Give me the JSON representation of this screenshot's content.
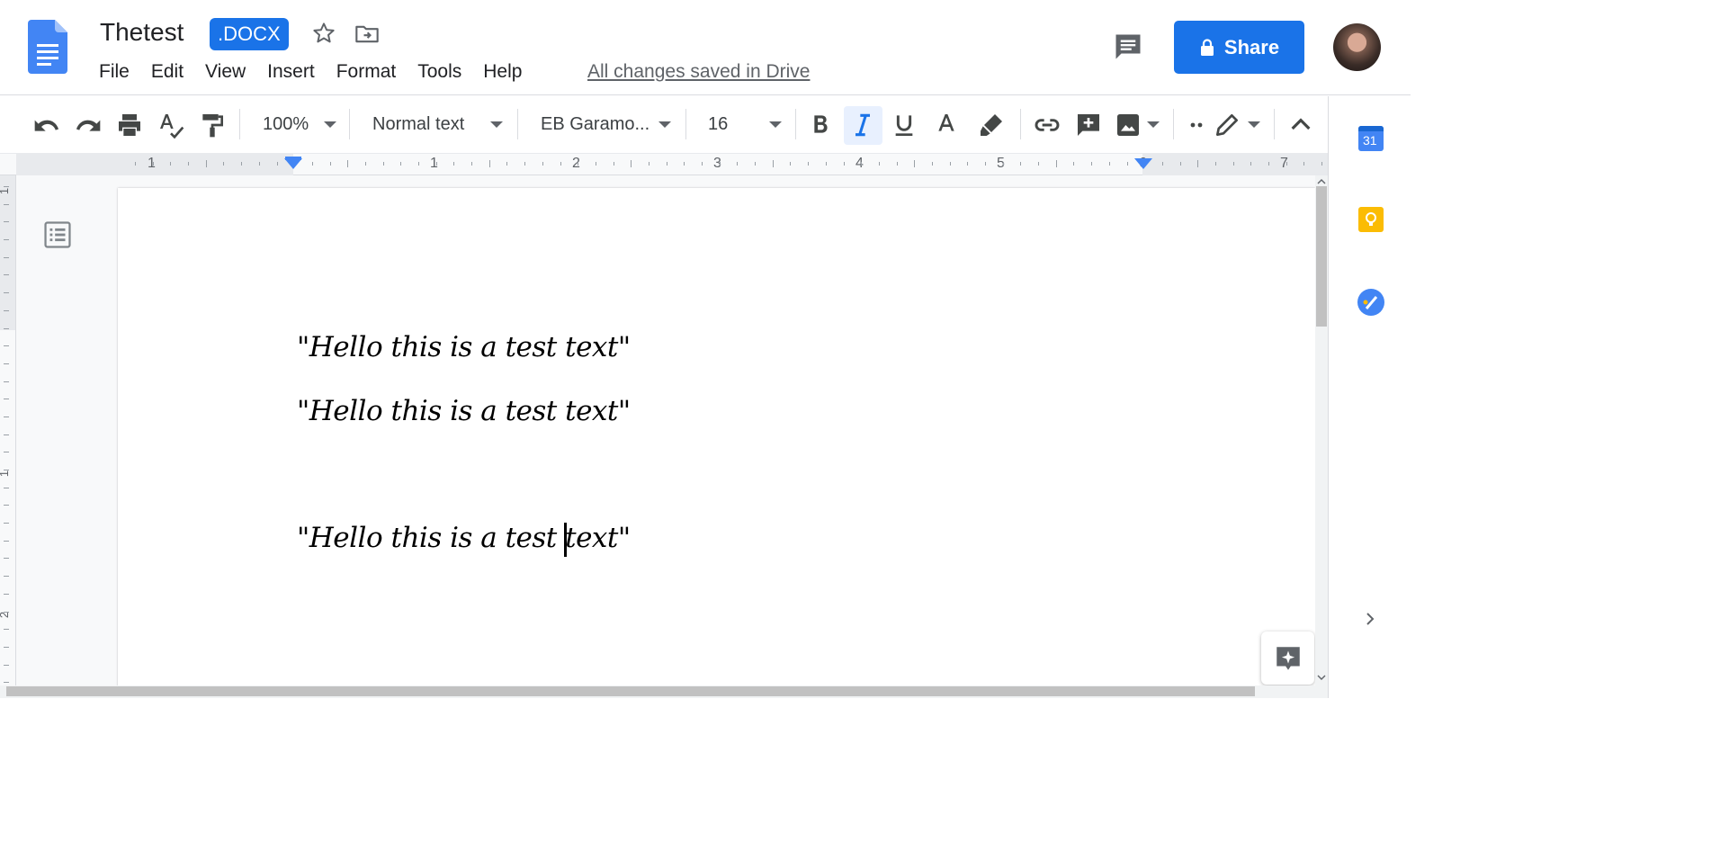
{
  "header": {
    "doc_title": "Thetest",
    "badge": ".DOCX",
    "menu": [
      "File",
      "Edit",
      "View",
      "Insert",
      "Format",
      "Tools",
      "Help"
    ],
    "saved_status": "All changes saved in Drive",
    "share_label": "Share"
  },
  "toolbar": {
    "zoom": "100%",
    "style": "Normal text",
    "font": "EB Garamo...",
    "font_size": "16"
  },
  "ruler": {
    "labels": [
      "1",
      "1",
      "2",
      "3",
      "4",
      "5",
      "6",
      "7"
    ],
    "vertical_labels": [
      "1",
      "1",
      "2"
    ]
  },
  "document": {
    "lines": [
      "\"Hello this is a test text\"",
      "\"Hello this is a test text\"",
      "\"Hello this is a test text\""
    ]
  },
  "side_panel": {
    "calendar_day": "31"
  },
  "colors": {
    "accent": "#1a73e8",
    "docs_blue": "#4285f4",
    "keep_yellow": "#fbbc04",
    "text_color_bar": "#000000"
  }
}
